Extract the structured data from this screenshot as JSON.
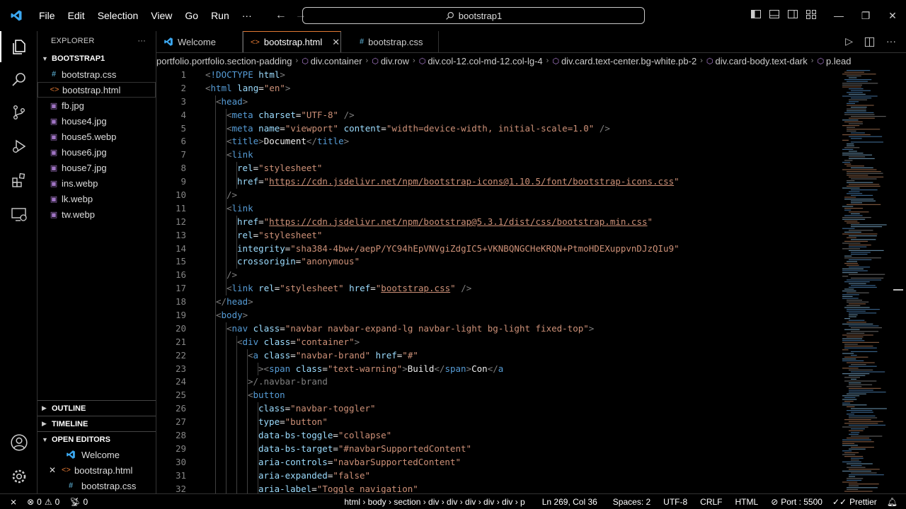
{
  "titlebar": {
    "menu": [
      "File",
      "Edit",
      "Selection",
      "View",
      "Go",
      "Run",
      "···"
    ],
    "search": "bootstrap1"
  },
  "explorer": {
    "title": "EXPLORER",
    "more": "···",
    "folder": "BOOTSTRAP1",
    "files": [
      {
        "name": "bootstrap.css",
        "icon": "#"
      },
      {
        "name": "bootstrap.html",
        "icon": "<>"
      },
      {
        "name": "fb.jpg",
        "icon": "▣"
      },
      {
        "name": "house4.jpg",
        "icon": "▣"
      },
      {
        "name": "house5.webp",
        "icon": "▣"
      },
      {
        "name": "house6.jpg",
        "icon": "▣"
      },
      {
        "name": "house7.jpg",
        "icon": "▣"
      },
      {
        "name": "ins.webp",
        "icon": "▣"
      },
      {
        "name": "lk.webp",
        "icon": "▣"
      },
      {
        "name": "tw.webp",
        "icon": "▣"
      }
    ],
    "outline": "OUTLINE",
    "timeline": "TIMELINE",
    "open_editors": "OPEN EDITORS",
    "open_items": [
      {
        "name": "Welcome",
        "close": ""
      },
      {
        "name": "bootstrap.html",
        "close": "✕"
      },
      {
        "name": "bootstrap.css",
        "close": ""
      }
    ]
  },
  "tabs": [
    {
      "label": "Welcome",
      "icon": "vscode-icon"
    },
    {
      "label": "bootstrap.html",
      "icon": "<>",
      "close": "✕"
    },
    {
      "label": "bootstrap.css",
      "icon": "#"
    }
  ],
  "breadcrumb": [
    "portfolio.portfolio.section-padding",
    "div.container",
    "div.row",
    "div.col-12.col-md-12.col-lg-4",
    "div.card.text-center.bg-white.pb-2",
    "div.card-body.text-dark",
    "p.lead"
  ],
  "code_lines": [
    "1",
    "2",
    "3",
    "4",
    "5",
    "6",
    "7",
    "8",
    "9",
    "10",
    "11",
    "12",
    "13",
    "14",
    "15",
    "16",
    "17",
    "18",
    "19",
    "20",
    "21",
    "22",
    "23",
    "24",
    "25",
    "26",
    "27",
    "28",
    "29",
    "30",
    "31",
    "32"
  ],
  "statusbar": {
    "errors": "0",
    "warnings": "0",
    "ports_icon_count": "0",
    "path": "html › body › section › div › div › div › div › div › p",
    "position": "Ln 269, Col 36",
    "spaces": "Spaces: 2",
    "encoding": "UTF-8",
    "eol": "CRLF",
    "language": "HTML",
    "port": "Port : 5500",
    "formatter": "Prettier"
  }
}
